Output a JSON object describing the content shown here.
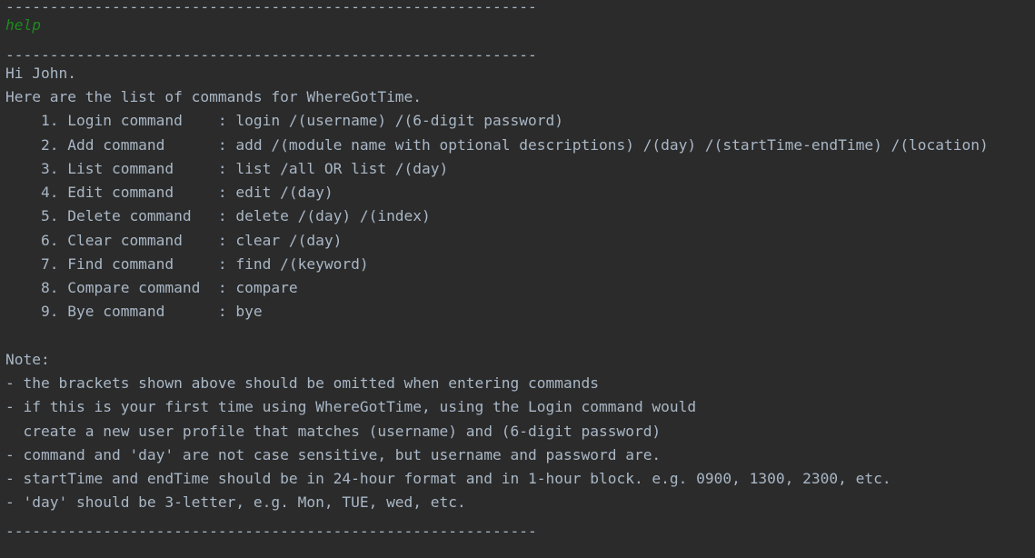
{
  "console": {
    "separator": "------------------------------------------------------------",
    "user_input": "help",
    "greeting": "Hi John.",
    "intro": "Here are the list of commands for WhereGotTime.",
    "commands": [
      "    1. Login command    : login /(username) /(6-digit password)",
      "    2. Add command      : add /(module name with optional descriptions) /(day) /(startTime-endTime) /(location)",
      "    3. List command     : list /all OR list /(day)",
      "    4. Edit command     : edit /(day)",
      "    5. Delete command   : delete /(day) /(index)",
      "    6. Clear command    : clear /(day)",
      "    7. Find command     : find /(keyword)",
      "    8. Compare command  : compare",
      "    9. Bye command      : bye"
    ],
    "note_title": "Note:",
    "notes": [
      "- the brackets shown above should be omitted when entering commands",
      "- if this is your first time using WhereGotTime, using the Login command would",
      "  create a new user profile that matches (username) and (6-digit password)",
      "- command and 'day' are not case sensitive, but username and password are.",
      "- startTime and endTime should be in 24-hour format and in 1-hour block. e.g. 0900, 1300, 2300, etc.",
      "- 'day' should be 3-letter, e.g. Mon, TUE, wed, etc."
    ]
  }
}
